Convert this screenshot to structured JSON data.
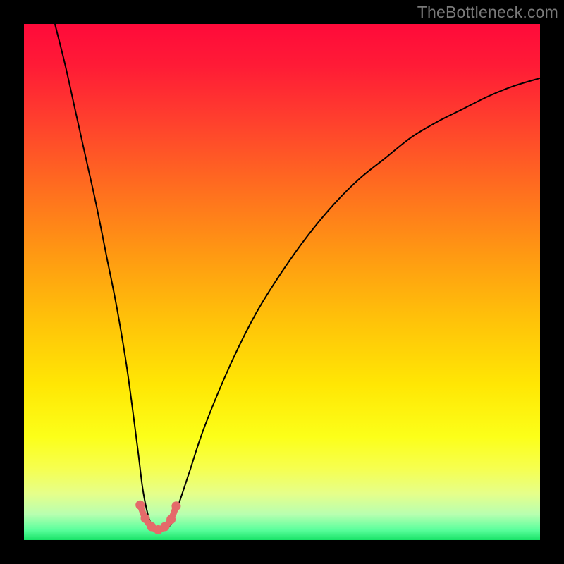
{
  "watermark": "TheBottleneck.com",
  "chart_data": {
    "type": "line",
    "title": "",
    "xlabel": "",
    "ylabel": "",
    "xlim": [
      0,
      100
    ],
    "ylim": [
      0,
      100
    ],
    "grid": false,
    "series": [
      {
        "name": "bottleneck-curve",
        "x": [
          6,
          8,
          10,
          12,
          14,
          16,
          18,
          20,
          22,
          23,
          24,
          25,
          26,
          27,
          28,
          29,
          30,
          32,
          35,
          40,
          45,
          50,
          55,
          60,
          65,
          70,
          75,
          80,
          85,
          90,
          95,
          100
        ],
        "y": [
          100,
          92,
          83,
          74,
          65,
          55,
          45,
          33,
          18,
          10,
          5,
          2.5,
          2,
          2,
          2.5,
          4,
          7,
          13,
          22,
          34,
          44,
          52,
          59,
          65,
          70,
          74,
          78,
          81,
          83.5,
          86,
          88,
          89.5
        ]
      }
    ],
    "markers": {
      "name": "valley-dots",
      "x": [
        22.5,
        23.5,
        24.7,
        26.0,
        27.3,
        28.5,
        29.5
      ],
      "y": [
        6.8,
        4.2,
        2.6,
        2.0,
        2.6,
        4.0,
        6.6
      ]
    },
    "colors": {
      "curve": "#000000",
      "markers": "#e46a6a",
      "gradient_top": "#ff0a3a",
      "gradient_bottom": "#18e267"
    }
  }
}
